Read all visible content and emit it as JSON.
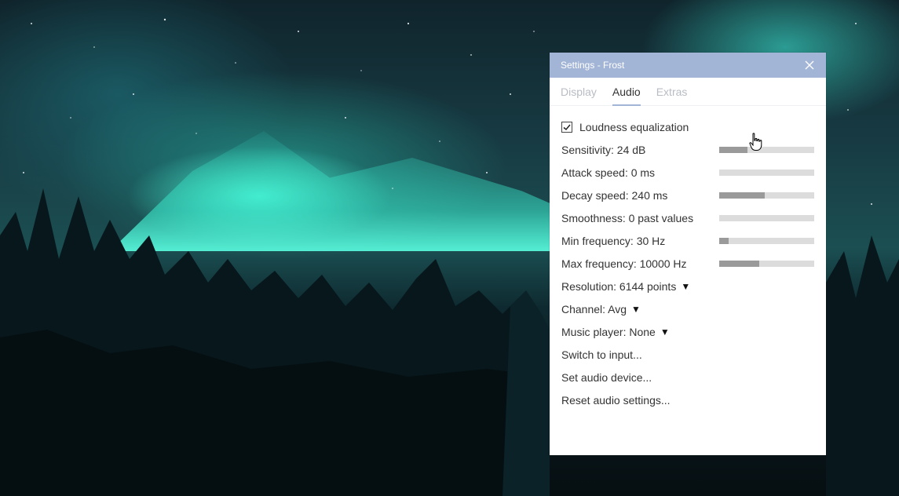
{
  "window": {
    "title": "Settings - Frost",
    "close_icon": "close-icon"
  },
  "tabs": [
    {
      "label": "Display",
      "active": false
    },
    {
      "label": "Audio",
      "active": true
    },
    {
      "label": "Extras",
      "active": false
    }
  ],
  "audio": {
    "loudness": {
      "label": "Loudness equalization",
      "checked": true
    },
    "sliders": [
      {
        "label": "Sensitivity: 24 dB",
        "fraction": 0.3
      },
      {
        "label": "Attack speed: 0 ms",
        "fraction": 0.0
      },
      {
        "label": "Decay speed: 240 ms",
        "fraction": 0.48
      },
      {
        "label": "Smoothness: 0 past values",
        "fraction": 0.0
      },
      {
        "label": "Min frequency: 30 Hz",
        "fraction": 0.1
      },
      {
        "label": "Max frequency: 10000 Hz",
        "fraction": 0.42
      }
    ],
    "dropdowns": [
      {
        "label": "Resolution: 6144 points",
        "arrow": "▼"
      },
      {
        "label": "Channel: Avg",
        "arrow": "▼"
      },
      {
        "label": "Music player: None",
        "arrow": "▼"
      }
    ],
    "actions": [
      {
        "label": "Switch to input..."
      },
      {
        "label": "Set audio device..."
      },
      {
        "label": "Reset audio settings..."
      }
    ]
  },
  "colors": {
    "titlebar": "#a3b5d6",
    "slider_track": "#dcdcdc",
    "slider_fill": "#9a9a9a"
  }
}
